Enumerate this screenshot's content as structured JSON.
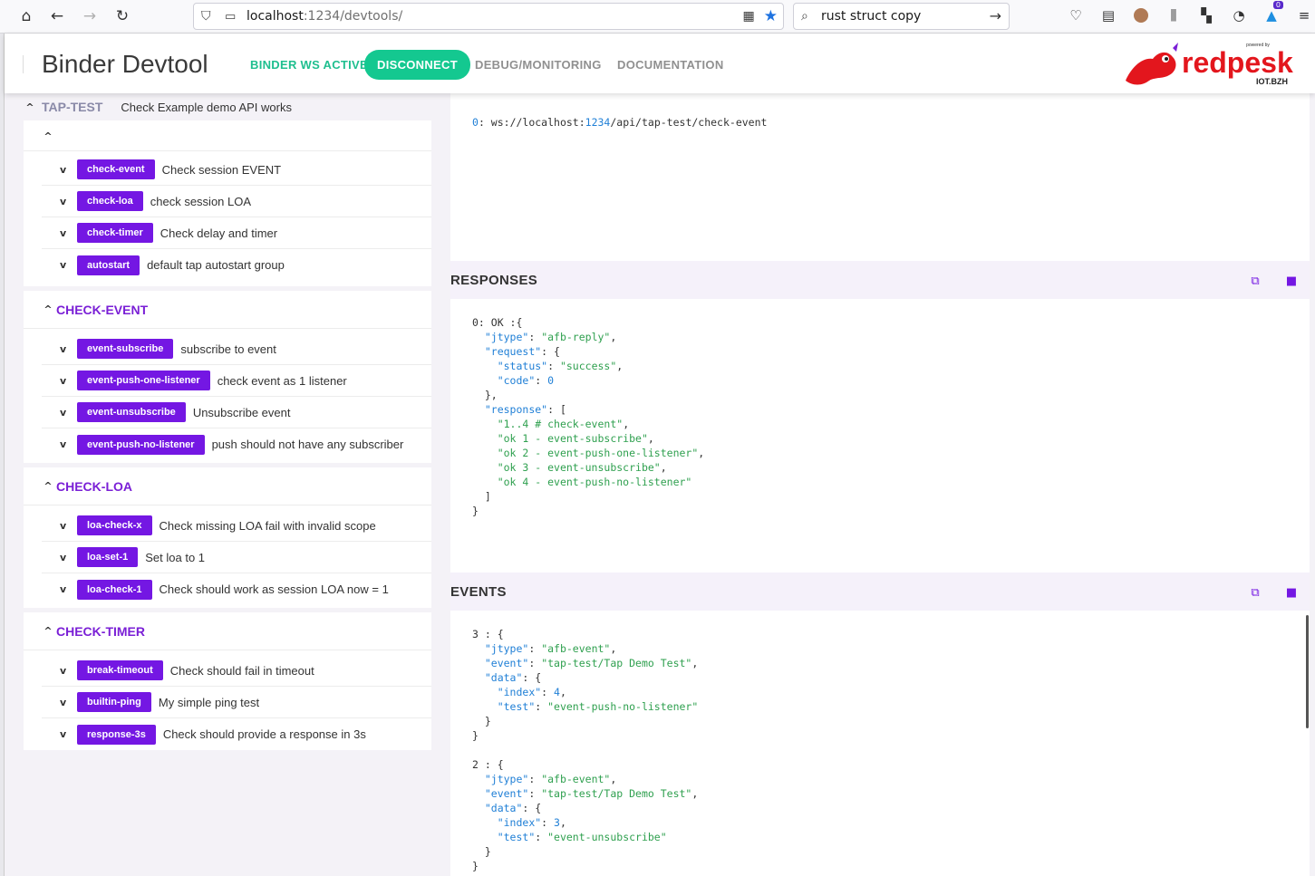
{
  "browser": {
    "url_host": "localhost",
    "url_rest": ":1234/devtools/",
    "search_query": "rust struct copy",
    "notif_badge": "0"
  },
  "header": {
    "title": "Binder Devtool",
    "ws_status": "BINDER WS ACTIVE",
    "disconnect": "DISCONNECT",
    "debug": "DEBUG/MONITORING",
    "documentation": "DOCUMENTATION",
    "logo_text": "redpesk",
    "logo_powered": "powered by",
    "logo_sub": "IOT.BZH"
  },
  "left": {
    "tap_title": "TAP-TEST",
    "tap_desc": "Check Example demo API works",
    "groups": [
      {
        "title": "",
        "items": [
          {
            "tag": "check-event",
            "desc": "Check session EVENT"
          },
          {
            "tag": "check-loa",
            "desc": "check session LOA"
          },
          {
            "tag": "check-timer",
            "desc": "Check delay and timer"
          },
          {
            "tag": "autostart",
            "desc": "default tap autostart group"
          }
        ]
      },
      {
        "title": "CHECK-EVENT",
        "items": [
          {
            "tag": "event-subscribe",
            "desc": "subscribe to event"
          },
          {
            "tag": "event-push-one-listener",
            "desc": "check event as 1 listener"
          },
          {
            "tag": "event-unsubscribe",
            "desc": "Unsubscribe event"
          },
          {
            "tag": "event-push-no-listener",
            "desc": "push should not have any subscriber"
          }
        ]
      },
      {
        "title": "CHECK-LOA",
        "items": [
          {
            "tag": "loa-check-x",
            "desc": "Check missing LOA fail with invalid scope"
          },
          {
            "tag": "loa-set-1",
            "desc": "Set loa to 1"
          },
          {
            "tag": "loa-check-1",
            "desc": "Check should work as session LOA now = 1"
          }
        ]
      },
      {
        "title": "CHECK-TIMER",
        "items": [
          {
            "tag": "break-timeout",
            "desc": "Check should fail in timeout"
          },
          {
            "tag": "builtin-ping",
            "desc": "My simple ping test"
          },
          {
            "tag": "response-3s",
            "desc": "Check should provide a response in 3s"
          }
        ]
      }
    ]
  },
  "right": {
    "request_line": {
      "index": "0",
      "prefix": "ws://localhost:",
      "port": "1234",
      "path": "/api/tap-test/check-event"
    },
    "responses_title": "RESPONSES",
    "events_title": "EVENTS"
  }
}
